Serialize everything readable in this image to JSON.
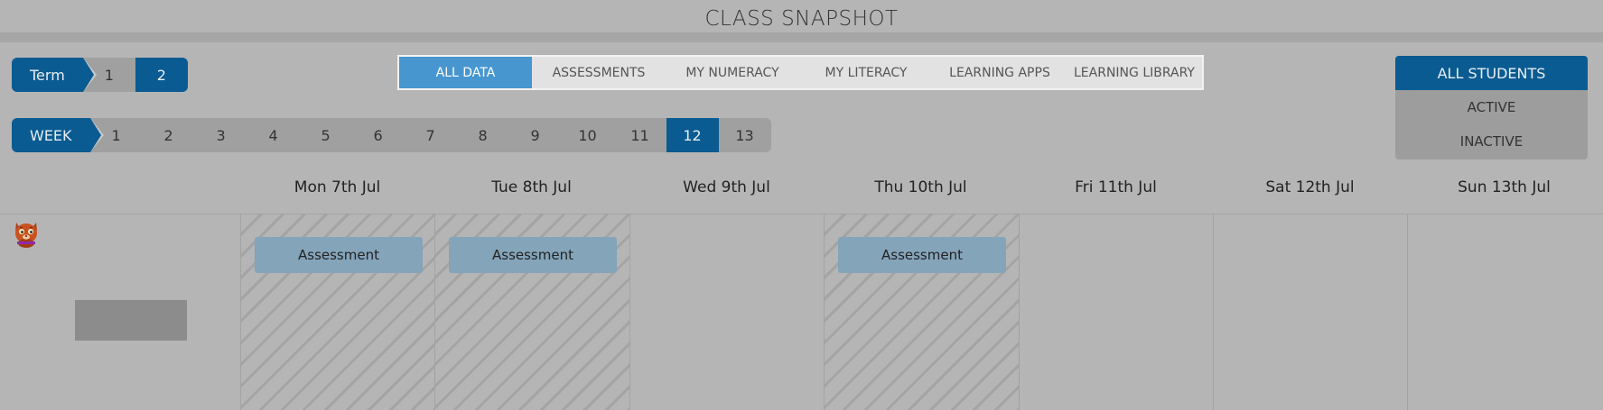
{
  "header": {
    "title": "CLASS SNAPSHOT"
  },
  "term": {
    "label": "Term",
    "options": [
      "1",
      "2"
    ],
    "selected": "2"
  },
  "week": {
    "label": "WEEK",
    "options": [
      "1",
      "2",
      "3",
      "4",
      "5",
      "6",
      "7",
      "8",
      "9",
      "10",
      "11",
      "12",
      "13"
    ],
    "selected": "12"
  },
  "tabs": [
    {
      "label": "ALL DATA",
      "active": true
    },
    {
      "label": "ASSESSMENTS",
      "active": false
    },
    {
      "label": "MY NUMERACY",
      "active": false
    },
    {
      "label": "MY LITERACY",
      "active": false
    },
    {
      "label": "LEARNING APPS",
      "active": false
    },
    {
      "label": "LEARNING LIBRARY",
      "active": false
    }
  ],
  "student_filter": {
    "options": [
      "ALL STUDENTS",
      "ACTIVE",
      "INACTIVE"
    ],
    "selected": "ALL STUDENTS"
  },
  "calendar": {
    "days": [
      {
        "label": "Mon 7th Jul",
        "has_assessment": true
      },
      {
        "label": "Tue 8th Jul",
        "has_assessment": true
      },
      {
        "label": "Wed 9th Jul",
        "has_assessment": false
      },
      {
        "label": "Thu 10th Jul",
        "has_assessment": true
      },
      {
        "label": "Fri 11th Jul",
        "has_assessment": false
      },
      {
        "label": "Sat 12th Jul",
        "has_assessment": false
      },
      {
        "label": "Sun 13th Jul",
        "has_assessment": false
      }
    ],
    "assessment_label": "Assessment"
  },
  "student": {
    "avatar_icon": "cat-avatar-icon"
  },
  "colors": {
    "primary": "#0a5b91",
    "tab_active": "#4796cf",
    "assessment": "#84a4ba",
    "background": "#b5b5b5"
  }
}
